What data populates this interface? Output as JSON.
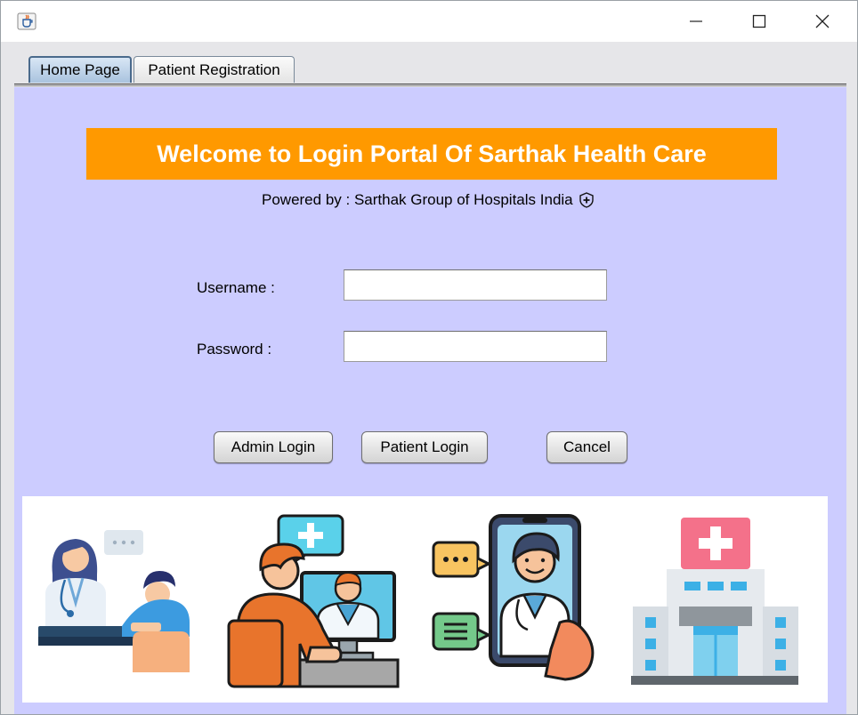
{
  "window": {
    "app_icon": "java-cup-icon",
    "controls": [
      "minimize-icon",
      "maximize-icon",
      "close-icon"
    ]
  },
  "tabs": [
    {
      "label": "Home Page",
      "active": true
    },
    {
      "label": "Patient Registration",
      "active": false
    }
  ],
  "banner": {
    "title": "Welcome to Login Portal Of Sarthak Health Care",
    "background": "#ff9900",
    "text_color": "#ffffff"
  },
  "powered_by": {
    "text": "Powered by : Sarthak Group of Hospitals India",
    "icon": "shield-plus-icon"
  },
  "form": {
    "username_label": "Username :",
    "username_value": "",
    "password_label": "Password :",
    "password_value": ""
  },
  "buttons": {
    "admin_login": "Admin Login",
    "patient_login": "Patient Login",
    "cancel": "Cancel"
  },
  "illustrations": [
    "doctor-consultation-icon",
    "video-call-doctor-icon",
    "mobile-doctor-chat-icon",
    "hospital-building-icon"
  ],
  "colors": {
    "panel_background": "#ccccff",
    "active_tab": "#a9c3de"
  }
}
